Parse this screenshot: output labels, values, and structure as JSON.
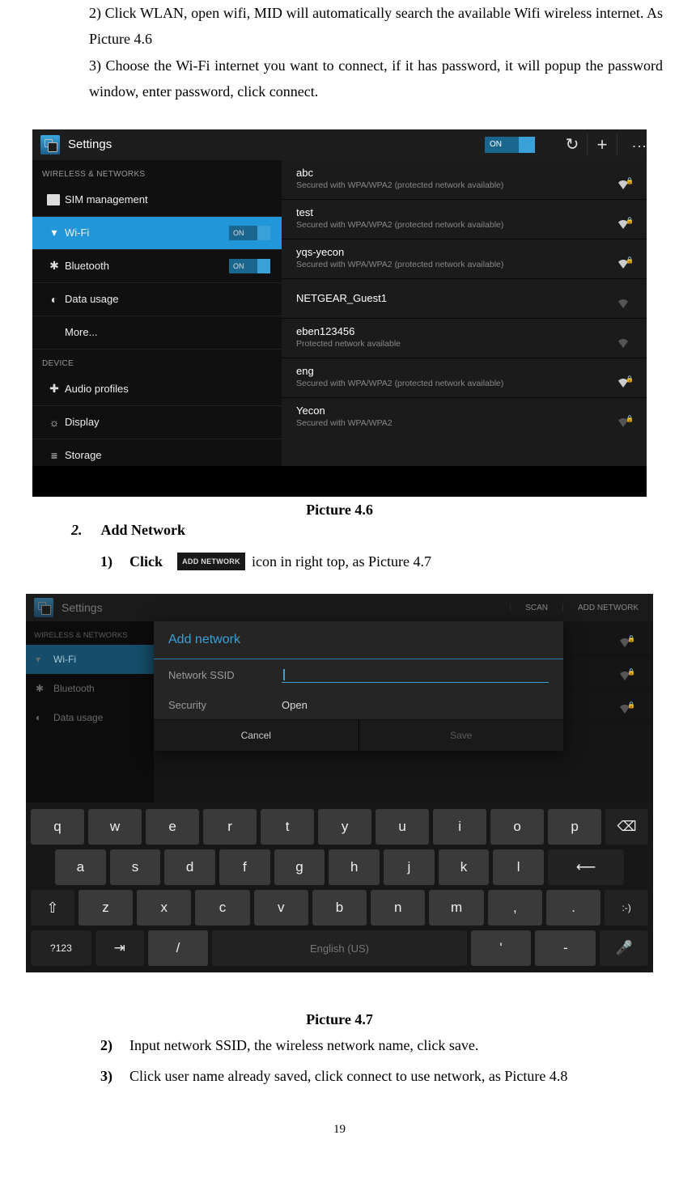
{
  "intro": {
    "step2": "2)  Click WLAN, open wifi, MID will automatically search the available Wifi wireless internet. As Picture 4.6",
    "step3": "3)    Choose the Wi-Fi internet you want to connect, if it has password, it will popup the password window, enter password, click connect."
  },
  "screenshot1": {
    "title": "Settings",
    "toggle": "ON",
    "left": {
      "section1": "WIRELESS & NETWORKS",
      "items1": [
        {
          "icon": "sim",
          "label": "SIM management",
          "toggle": ""
        },
        {
          "icon": "wifi",
          "label": "Wi-Fi",
          "toggle": "ON",
          "sel": true
        },
        {
          "icon": "bt",
          "label": "Bluetooth",
          "toggle": "ON"
        },
        {
          "icon": "data",
          "label": "Data usage",
          "toggle": ""
        },
        {
          "icon": "",
          "label": "More...",
          "toggle": ""
        }
      ],
      "section2": "DEVICE",
      "items2": [
        {
          "icon": "audio",
          "label": "Audio profiles"
        },
        {
          "icon": "disp",
          "label": "Display"
        },
        {
          "icon": "stor",
          "label": "Storage"
        }
      ]
    },
    "networks": [
      {
        "name": "abc",
        "sub": "Secured with WPA/WPA2 (protected network available)",
        "strong": true,
        "lock": true
      },
      {
        "name": "test",
        "sub": "Secured with WPA/WPA2 (protected network available)",
        "strong": true,
        "lock": true
      },
      {
        "name": "yqs-yecon",
        "sub": "Secured with WPA/WPA2 (protected network available)",
        "strong": true,
        "lock": true
      },
      {
        "name": "NETGEAR_Guest1",
        "sub": "",
        "strong": false,
        "lock": false
      },
      {
        "name": "eben123456",
        "sub": "Protected network available",
        "strong": false,
        "lock": false
      },
      {
        "name": "eng",
        "sub": "Secured with WPA/WPA2 (protected network available)",
        "strong": true,
        "lock": true
      },
      {
        "name": "Yecon",
        "sub": "Secured with WPA/WPA2",
        "strong": false,
        "lock": true
      }
    ]
  },
  "caption1": "Picture 4.6",
  "section2": {
    "num": "2.",
    "title": "Add Network",
    "step1_pre": "Click",
    "step1_btn": "ADD NETWORK",
    "step1_post": " icon in right top, as Picture 4.7"
  },
  "screenshot2": {
    "title": "Settings",
    "scan": "SCAN",
    "addn": "ADD NETWORK",
    "left": {
      "hdr": "WIRELESS & NETWORKS",
      "items": [
        {
          "icon": "wifi",
          "label": "Wi-Fi",
          "sel": true
        },
        {
          "icon": "bt",
          "label": "Bluetooth"
        },
        {
          "icon": "data",
          "label": "Data usage"
        }
      ]
    },
    "dialog": {
      "title": "Add network",
      "ssid_lbl": "Network SSID",
      "sec_lbl": "Security",
      "sec_val": "Open",
      "cancel": "Cancel",
      "save": "Save"
    },
    "keyboard": {
      "row1": [
        "q",
        "w",
        "e",
        "r",
        "t",
        "y",
        "u",
        "i",
        "o",
        "p"
      ],
      "row2": [
        "a",
        "s",
        "d",
        "f",
        "g",
        "h",
        "j",
        "k",
        "l"
      ],
      "row3": [
        "z",
        "x",
        "c",
        "v",
        "b",
        "n",
        "m",
        ",",
        "."
      ],
      "space": "English (US)",
      "numkey": "?123"
    }
  },
  "caption2": "Picture 4.7",
  "steps_after": {
    "s2": "Input network SSID, the wireless network name, click save.",
    "s3": "Click user name already saved, click connect to use network, as Picture 4.8"
  },
  "pagenum": "19"
}
